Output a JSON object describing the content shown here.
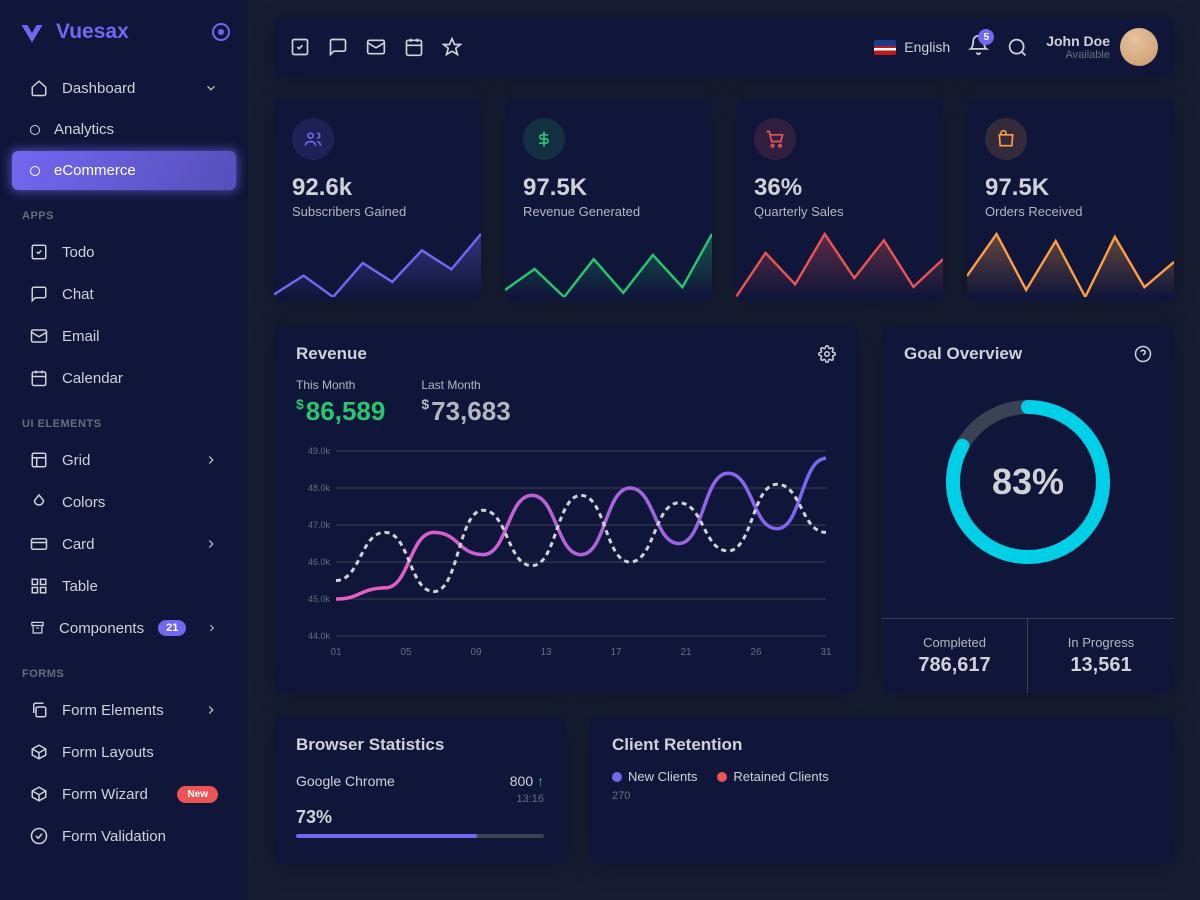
{
  "brand": {
    "name": "Vuesax"
  },
  "sidebar": {
    "dashboard_label": "Dashboard",
    "analytics_label": "Analytics",
    "ecommerce_label": "eCommerce",
    "sections": {
      "apps": "APPS",
      "ui": "UI ELEMENTS",
      "forms": "FORMS"
    },
    "apps": {
      "todo": "Todo",
      "chat": "Chat",
      "email": "Email",
      "calendar": "Calendar"
    },
    "ui": {
      "grid": "Grid",
      "colors": "Colors",
      "card": "Card",
      "table": "Table",
      "components": "Components",
      "components_badge": "21"
    },
    "forms": {
      "elements": "Form Elements",
      "layouts": "Form Layouts",
      "wizard": "Form Wizard",
      "wizard_badge": "New",
      "validation": "Form Validation"
    }
  },
  "topbar": {
    "language": "English",
    "notif_count": "5",
    "user_name": "John Doe",
    "user_status": "Available"
  },
  "stats": [
    {
      "value": "92.6k",
      "label": "Subscribers Gained",
      "color": "#7367f0",
      "bg": "rgba(115,103,240,0.15)",
      "icon": "users"
    },
    {
      "value": "97.5K",
      "label": "Revenue Generated",
      "color": "#28c76f",
      "bg": "rgba(40,199,111,0.15)",
      "icon": "dollar"
    },
    {
      "value": "36%",
      "label": "Quarterly Sales",
      "color": "#ea5455",
      "bg": "rgba(234,84,85,0.15)",
      "icon": "cart"
    },
    {
      "value": "97.5K",
      "label": "Orders Received",
      "color": "#ff9f43",
      "bg": "rgba(255,159,67,0.15)",
      "icon": "bag"
    }
  ],
  "revenue": {
    "title": "Revenue",
    "this_label": "This Month",
    "this_val": "86,589",
    "last_label": "Last Month",
    "last_val": "73,683",
    "this_color": "#28c76f",
    "last_color": "#b4b7bd"
  },
  "goal": {
    "title": "Goal Overview",
    "pct": "83%",
    "completed_label": "Completed",
    "completed_val": "786,617",
    "inprog_label": "In Progress",
    "inprog_val": "13,561"
  },
  "browser": {
    "title": "Browser Statistics",
    "name": "Google Chrome",
    "count": "800",
    "time": "13:16",
    "pct": "73%"
  },
  "retention": {
    "title": "Client Retention",
    "legend_new": "New Clients",
    "legend_retained": "Retained Clients",
    "axis_tick": "270"
  },
  "chart_data": {
    "revenue": {
      "type": "line",
      "x_ticks": [
        "01",
        "05",
        "09",
        "13",
        "17",
        "21",
        "26",
        "31"
      ],
      "y_ticks": [
        "44.0k",
        "45.0k",
        "46.0k",
        "47.0k",
        "48.0k",
        "49.0k"
      ],
      "ylim": [
        44000,
        49000
      ],
      "series": [
        {
          "name": "This Month",
          "color": "#7367f0",
          "values": [
            45000,
            45300,
            46800,
            46200,
            47800,
            46200,
            48000,
            46500,
            48400,
            46900,
            48800
          ]
        },
        {
          "name": "Last Month",
          "color": "#d0d2d6",
          "style": "dashed",
          "values": [
            45500,
            46800,
            45200,
            47400,
            45900,
            47800,
            46000,
            47600,
            46300,
            48100,
            46800
          ]
        }
      ]
    },
    "sparklines": [
      {
        "values": [
          30,
          45,
          28,
          55,
          40,
          65,
          50,
          78
        ],
        "color": "#7367f0"
      },
      {
        "values": [
          40,
          55,
          35,
          62,
          38,
          65,
          42,
          80
        ],
        "color": "#28c76f"
      },
      {
        "values": [
          20,
          55,
          30,
          70,
          35,
          65,
          28,
          50
        ],
        "color": "#ea5455"
      },
      {
        "values": [
          50,
          80,
          40,
          75,
          35,
          78,
          42,
          60
        ],
        "color": "#ff9f43"
      }
    ],
    "goal_pct": 83,
    "browser_pct": 73
  }
}
